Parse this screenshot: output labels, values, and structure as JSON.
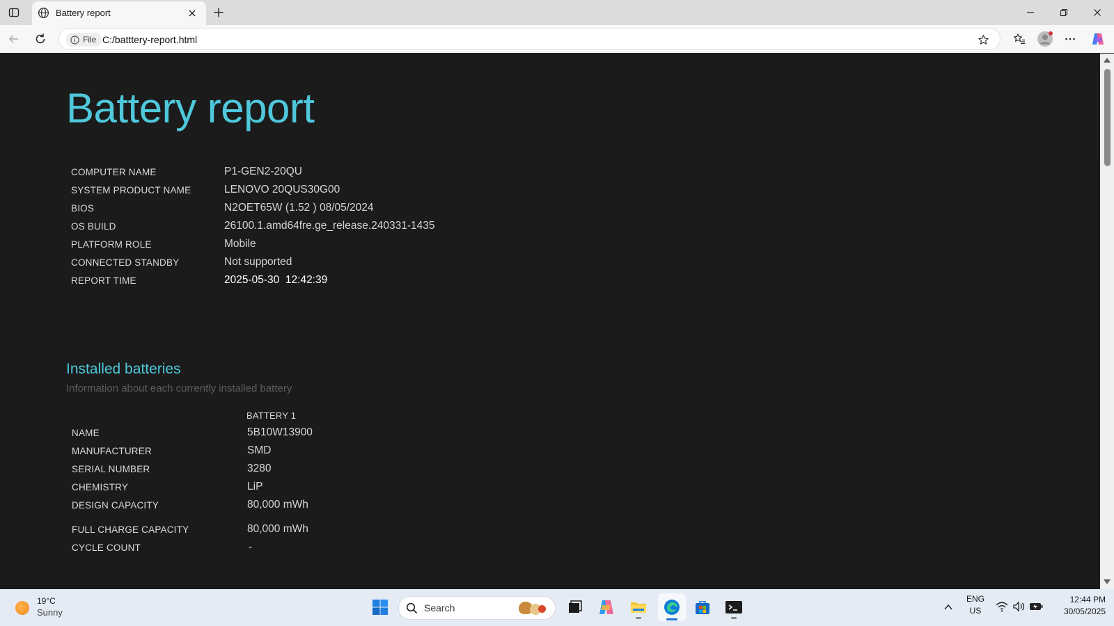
{
  "browser": {
    "tab_title": "Battery report",
    "file_badge": "File",
    "url": "C:/batttery-report.html"
  },
  "report": {
    "title": "Battery report",
    "system_info": [
      {
        "label": "COMPUTER NAME",
        "value": "P1-GEN2-20QU"
      },
      {
        "label": "SYSTEM PRODUCT NAME",
        "value": "LENOVO 20QUS30G00"
      },
      {
        "label": "BIOS",
        "value": "N2OET65W (1.52 ) 08/05/2024"
      },
      {
        "label": "OS BUILD",
        "value": "26100.1.amd64fre.ge_release.240331-1435"
      },
      {
        "label": "PLATFORM ROLE",
        "value": "Mobile"
      },
      {
        "label": "CONNECTED STANDBY",
        "value": "Not supported"
      },
      {
        "label": "REPORT TIME",
        "value": "2025-05-30  12:42:39"
      }
    ],
    "installed_batteries": {
      "heading": "Installed batteries",
      "subheading": "Information about each currently installed battery",
      "column_header": "BATTERY 1",
      "rows": [
        {
          "label": "NAME",
          "value": "5B10W13900"
        },
        {
          "label": "MANUFACTURER",
          "value": "SMD"
        },
        {
          "label": "SERIAL NUMBER",
          "value": "3280"
        },
        {
          "label": "CHEMISTRY",
          "value": "LiP"
        },
        {
          "label": "DESIGN CAPACITY",
          "value": "80,000 mWh"
        },
        {
          "label": "FULL CHARGE CAPACITY",
          "value": "80,000 mWh"
        },
        {
          "label": "CYCLE COUNT",
          "value": "-"
        }
      ]
    }
  },
  "taskbar": {
    "weather_temp": "19°C",
    "weather_desc": "Sunny",
    "search_placeholder": "Search",
    "lang": "ENG",
    "region": "US",
    "time": "12:44 PM",
    "date": "30/05/2025"
  },
  "colors": {
    "accent": "#4fc8dc",
    "page_bg": "#1b1b1b"
  },
  "icons": [
    "sidebar-toggle-icon",
    "globe-icon",
    "close-icon",
    "plus-icon",
    "minimize-icon",
    "restore-icon",
    "back-icon",
    "refresh-icon",
    "info-icon",
    "star-icon",
    "favorites-icon",
    "profile-icon",
    "more-icon",
    "copilot-icon",
    "sun-icon",
    "windows-start-icon",
    "search-icon",
    "task-view-icon",
    "file-explorer-icon",
    "edge-icon",
    "store-icon",
    "terminal-icon",
    "chevron-up-icon",
    "wifi-icon",
    "volume-icon",
    "battery-icon"
  ]
}
